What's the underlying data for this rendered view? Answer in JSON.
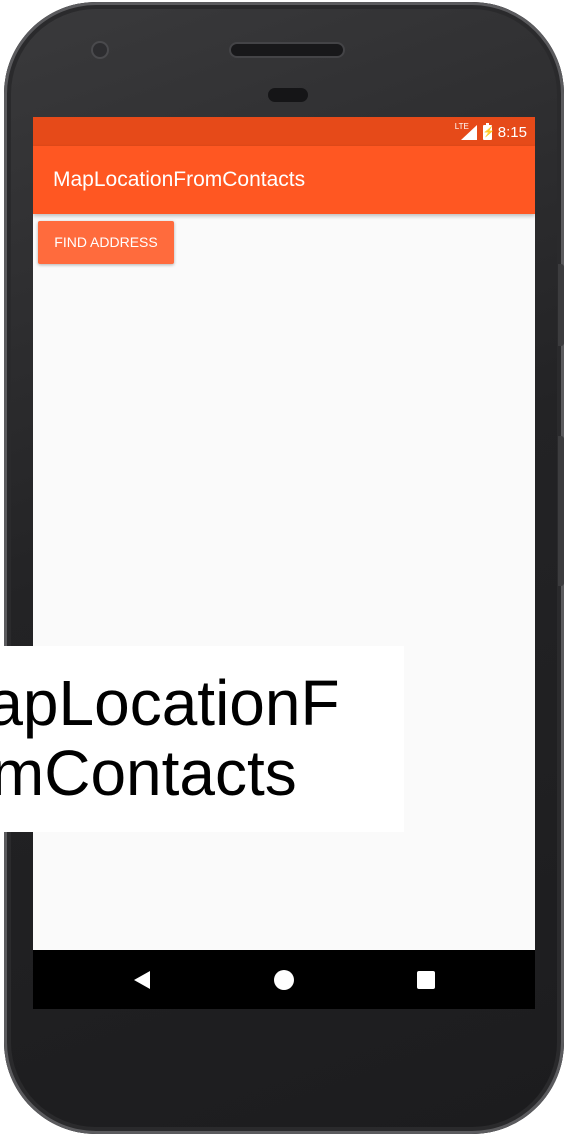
{
  "status_bar": {
    "network": "LTE",
    "time": "8:15"
  },
  "app_bar": {
    "title": "MapLocationFromContacts"
  },
  "content": {
    "find_address_label": "FIND ADDRESS"
  },
  "caption": {
    "line1": "MapLocationF",
    "line2": "romContacts"
  },
  "colors": {
    "status_bar": "#e64a19",
    "app_bar": "#ff5722",
    "button": "#ff6b3d",
    "screen_background": "#fafafa",
    "nav_bar": "#000000"
  },
  "icons": {
    "status": [
      "lte-signal-icon",
      "battery-charging-icon"
    ],
    "navigation": [
      "back-icon",
      "home-icon",
      "recents-icon"
    ]
  }
}
